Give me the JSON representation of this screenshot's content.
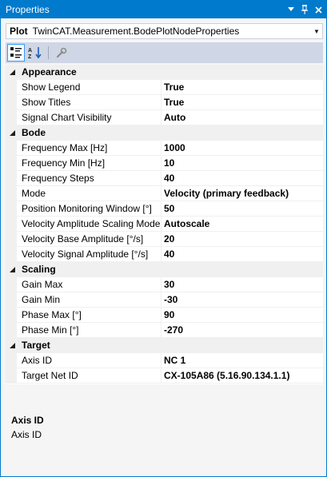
{
  "window": {
    "title": "Properties"
  },
  "selector": {
    "object_name": "Plot",
    "object_type": "TwinCAT.Measurement.BodePlotNodeProperties"
  },
  "toolbar": {
    "buttons": [
      {
        "name": "categorized-icon",
        "active": true
      },
      {
        "name": "alphabetical-icon",
        "active": false
      },
      {
        "name": "property-pages-icon",
        "active": false
      }
    ]
  },
  "grid": {
    "categories": [
      {
        "label": "Appearance",
        "properties": [
          {
            "name": "Show Legend",
            "value": "True"
          },
          {
            "name": "Show Titles",
            "value": "True"
          },
          {
            "name": "Signal Chart Visibility",
            "value": "Auto"
          }
        ]
      },
      {
        "label": "Bode",
        "properties": [
          {
            "name": "Frequency Max [Hz]",
            "value": "1000"
          },
          {
            "name": "Frequency Min [Hz]",
            "value": "10"
          },
          {
            "name": "Frequency Steps",
            "value": "40"
          },
          {
            "name": "Mode",
            "value": "Velocity (primary feedback)"
          },
          {
            "name": "Position Monitoring Window [°]",
            "value": "50"
          },
          {
            "name": "Velocity Amplitude Scaling Mode",
            "value": "Autoscale"
          },
          {
            "name": "Velocity Base Amplitude [°/s]",
            "value": "20"
          },
          {
            "name": "Velocity Signal Amplitude [°/s]",
            "value": "40"
          }
        ]
      },
      {
        "label": "Scaling",
        "properties": [
          {
            "name": "Gain Max",
            "value": "30"
          },
          {
            "name": "Gain Min",
            "value": "-30"
          },
          {
            "name": "Phase Max [°]",
            "value": "90"
          },
          {
            "name": "Phase Min [°]",
            "value": "-270"
          }
        ]
      },
      {
        "label": "Target",
        "properties": [
          {
            "name": "Axis ID",
            "value": "NC 1"
          },
          {
            "name": "Target Net ID",
            "value": "CX-105A86 (5.16.90.134.1.1)"
          }
        ]
      }
    ]
  },
  "description": {
    "title": "Axis ID",
    "text": "Axis ID"
  },
  "colors": {
    "accent": "#007acc",
    "toolbar": "#cfd6e5",
    "category_bg": "#f0f0f0"
  }
}
